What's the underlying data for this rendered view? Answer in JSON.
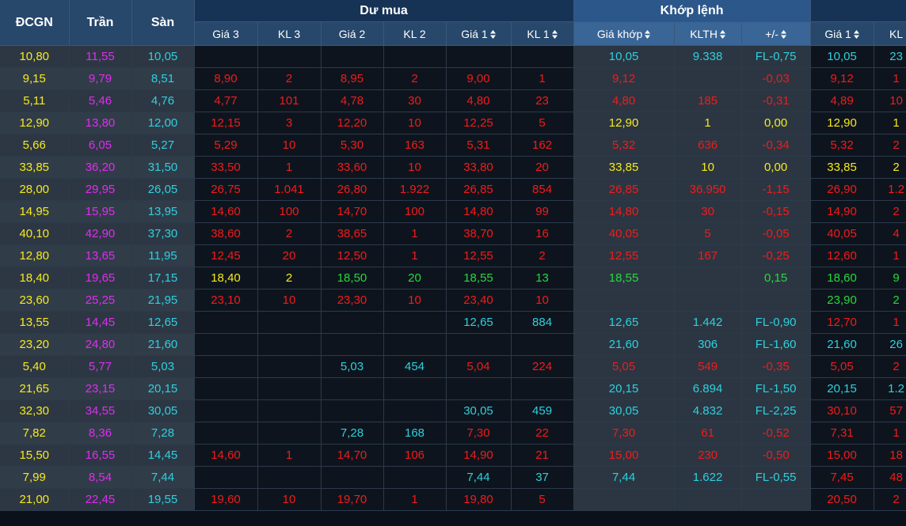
{
  "colors": {
    "ref": "#f5ea1d",
    "ceiling": "#e02cf0",
    "floor": "#2ed0de",
    "up": "#27d83d",
    "down": "#f21b1b",
    "header_bg": "#27476b",
    "match_header_bg": "#2b578a"
  },
  "header": {
    "ref": "ĐCGN",
    "ceiling": "Trần",
    "floor": "Sàn",
    "groups": {
      "bid": "Dư mua",
      "match": "Khớp lệnh",
      "ask": ""
    },
    "columns": {
      "bid_p3": "Giá 3",
      "bid_v3": "KL 3",
      "bid_p2": "Giá 2",
      "bid_v2": "KL 2",
      "bid_p1": "Giá 1",
      "bid_v1": "KL 1",
      "match_price": "Giá khớp",
      "match_vol": "KLTH",
      "match_change": "+/-",
      "ask_p1": "Giá 1",
      "ask_v1": "KL"
    },
    "sort_icon": "sort-up-down-icon"
  },
  "rows": [
    {
      "ref": "10,80",
      "ceil": "11,55",
      "floor": "10,05",
      "b3p": "",
      "b3v": "",
      "b2p": "",
      "b2v": "",
      "b1p": "",
      "b1v": "",
      "mp": "10,05",
      "mv": "9.338",
      "mc": "FL-0,75",
      "a1p": "10,05",
      "a1v": "23",
      "c": {
        "b3": "",
        "b2": "",
        "b1": "",
        "m": "floor",
        "a1": "floor"
      }
    },
    {
      "ref": "9,15",
      "ceil": "9,79",
      "floor": "8,51",
      "b3p": "8,90",
      "b3v": "2",
      "b2p": "8,95",
      "b2v": "2",
      "b1p": "9,00",
      "b1v": "1",
      "mp": "9,12",
      "mv": "",
      "mc": "-0,03",
      "a1p": "9,12",
      "a1v": "1",
      "c": {
        "b3": "down",
        "b2": "down",
        "b1": "down",
        "m": "down",
        "a1": "down"
      }
    },
    {
      "ref": "5,11",
      "ceil": "5,46",
      "floor": "4,76",
      "b3p": "4,77",
      "b3v": "101",
      "b2p": "4,78",
      "b2v": "30",
      "b1p": "4,80",
      "b1v": "23",
      "mp": "4,80",
      "mv": "185",
      "mc": "-0,31",
      "a1p": "4,89",
      "a1v": "10",
      "c": {
        "b3": "down",
        "b2": "down",
        "b1": "down",
        "m": "down",
        "a1": "down"
      }
    },
    {
      "ref": "12,90",
      "ceil": "13,80",
      "floor": "12,00",
      "b3p": "12,15",
      "b3v": "3",
      "b2p": "12,20",
      "b2v": "10",
      "b1p": "12,25",
      "b1v": "5",
      "mp": "12,90",
      "mv": "1",
      "mc": "0,00",
      "a1p": "12,90",
      "a1v": "1",
      "c": {
        "b3": "down",
        "b2": "down",
        "b1": "down",
        "m": "ref",
        "a1": "ref"
      }
    },
    {
      "ref": "5,66",
      "ceil": "6,05",
      "floor": "5,27",
      "b3p": "5,29",
      "b3v": "10",
      "b2p": "5,30",
      "b2v": "163",
      "b1p": "5,31",
      "b1v": "162",
      "mp": "5,32",
      "mv": "636",
      "mc": "-0,34",
      "a1p": "5,32",
      "a1v": "2",
      "c": {
        "b3": "down",
        "b2": "down",
        "b1": "down",
        "m": "down",
        "a1": "down"
      }
    },
    {
      "ref": "33,85",
      "ceil": "36,20",
      "floor": "31,50",
      "b3p": "33,50",
      "b3v": "1",
      "b2p": "33,60",
      "b2v": "10",
      "b1p": "33,80",
      "b1v": "20",
      "mp": "33,85",
      "mv": "10",
      "mc": "0,00",
      "a1p": "33,85",
      "a1v": "2",
      "c": {
        "b3": "down",
        "b2": "down",
        "b1": "down",
        "m": "ref",
        "a1": "ref"
      }
    },
    {
      "ref": "28,00",
      "ceil": "29,95",
      "floor": "26,05",
      "b3p": "26,75",
      "b3v": "1.041",
      "b2p": "26,80",
      "b2v": "1.922",
      "b1p": "26,85",
      "b1v": "854",
      "mp": "26,85",
      "mv": "36.950",
      "mc": "-1,15",
      "a1p": "26,90",
      "a1v": "1.2",
      "c": {
        "b3": "down",
        "b2": "down",
        "b1": "down",
        "m": "down",
        "a1": "down"
      }
    },
    {
      "ref": "14,95",
      "ceil": "15,95",
      "floor": "13,95",
      "b3p": "14,60",
      "b3v": "100",
      "b2p": "14,70",
      "b2v": "100",
      "b1p": "14,80",
      "b1v": "99",
      "mp": "14,80",
      "mv": "30",
      "mc": "-0,15",
      "a1p": "14,90",
      "a1v": "2",
      "c": {
        "b3": "down",
        "b2": "down",
        "b1": "down",
        "m": "down",
        "a1": "down"
      }
    },
    {
      "ref": "40,10",
      "ceil": "42,90",
      "floor": "37,30",
      "b3p": "38,60",
      "b3v": "2",
      "b2p": "38,65",
      "b2v": "1",
      "b1p": "38,70",
      "b1v": "16",
      "mp": "40,05",
      "mv": "5",
      "mc": "-0,05",
      "a1p": "40,05",
      "a1v": "4",
      "c": {
        "b3": "down",
        "b2": "down",
        "b1": "down",
        "m": "down",
        "a1": "down"
      }
    },
    {
      "ref": "12,80",
      "ceil": "13,65",
      "floor": "11,95",
      "b3p": "12,45",
      "b3v": "20",
      "b2p": "12,50",
      "b2v": "1",
      "b1p": "12,55",
      "b1v": "2",
      "mp": "12,55",
      "mv": "167",
      "mc": "-0,25",
      "a1p": "12,60",
      "a1v": "1",
      "c": {
        "b3": "down",
        "b2": "down",
        "b1": "down",
        "m": "down",
        "a1": "down"
      }
    },
    {
      "ref": "18,40",
      "ceil": "19,65",
      "floor": "17,15",
      "b3p": "18,40",
      "b3v": "2",
      "b2p": "18,50",
      "b2v": "20",
      "b1p": "18,55",
      "b1v": "13",
      "mp": "18,55",
      "mv": "",
      "mc": "0,15",
      "a1p": "18,60",
      "a1v": "9",
      "c": {
        "b3": "ref",
        "b2": "up",
        "b1": "up",
        "m": "up",
        "a1": "up"
      }
    },
    {
      "ref": "23,60",
      "ceil": "25,25",
      "floor": "21,95",
      "b3p": "23,10",
      "b3v": "10",
      "b2p": "23,30",
      "b2v": "10",
      "b1p": "23,40",
      "b1v": "10",
      "mp": "",
      "mv": "",
      "mc": "",
      "a1p": "23,90",
      "a1v": "2",
      "c": {
        "b3": "down",
        "b2": "down",
        "b1": "down",
        "m": "",
        "a1": "up"
      }
    },
    {
      "ref": "13,55",
      "ceil": "14,45",
      "floor": "12,65",
      "b3p": "",
      "b3v": "",
      "b2p": "",
      "b2v": "",
      "b1p": "12,65",
      "b1v": "884",
      "mp": "12,65",
      "mv": "1.442",
      "mc": "FL-0,90",
      "a1p": "12,70",
      "a1v": "1",
      "c": {
        "b3": "",
        "b2": "",
        "b1": "floor",
        "m": "floor",
        "a1": "down"
      }
    },
    {
      "ref": "23,20",
      "ceil": "24,80",
      "floor": "21,60",
      "b3p": "",
      "b3v": "",
      "b2p": "",
      "b2v": "",
      "b1p": "",
      "b1v": "",
      "mp": "21,60",
      "mv": "306",
      "mc": "FL-1,60",
      "a1p": "21,60",
      "a1v": "26",
      "c": {
        "b3": "",
        "b2": "",
        "b1": "",
        "m": "floor",
        "a1": "floor"
      }
    },
    {
      "ref": "5,40",
      "ceil": "5,77",
      "floor": "5,03",
      "b3p": "",
      "b3v": "",
      "b2p": "5,03",
      "b2v": "454",
      "b1p": "5,04",
      "b1v": "224",
      "mp": "5,05",
      "mv": "549",
      "mc": "-0,35",
      "a1p": "5,05",
      "a1v": "2",
      "c": {
        "b3": "",
        "b2": "floor",
        "b1": "down",
        "m": "down",
        "a1": "down"
      }
    },
    {
      "ref": "21,65",
      "ceil": "23,15",
      "floor": "20,15",
      "b3p": "",
      "b3v": "",
      "b2p": "",
      "b2v": "",
      "b1p": "",
      "b1v": "",
      "mp": "20,15",
      "mv": "6.894",
      "mc": "FL-1,50",
      "a1p": "20,15",
      "a1v": "1.2",
      "c": {
        "b3": "",
        "b2": "",
        "b1": "",
        "m": "floor",
        "a1": "floor"
      }
    },
    {
      "ref": "32,30",
      "ceil": "34,55",
      "floor": "30,05",
      "b3p": "",
      "b3v": "",
      "b2p": "",
      "b2v": "",
      "b1p": "30,05",
      "b1v": "459",
      "mp": "30,05",
      "mv": "4.832",
      "mc": "FL-2,25",
      "a1p": "30,10",
      "a1v": "57",
      "c": {
        "b3": "",
        "b2": "",
        "b1": "floor",
        "m": "floor",
        "a1": "down"
      }
    },
    {
      "ref": "7,82",
      "ceil": "8,36",
      "floor": "7,28",
      "b3p": "",
      "b3v": "",
      "b2p": "7,28",
      "b2v": "168",
      "b1p": "7,30",
      "b1v": "22",
      "mp": "7,30",
      "mv": "61",
      "mc": "-0,52",
      "a1p": "7,31",
      "a1v": "1",
      "c": {
        "b3": "",
        "b2": "floor",
        "b1": "down",
        "m": "down",
        "a1": "down"
      }
    },
    {
      "ref": "15,50",
      "ceil": "16,55",
      "floor": "14,45",
      "b3p": "14,60",
      "b3v": "1",
      "b2p": "14,70",
      "b2v": "106",
      "b1p": "14,90",
      "b1v": "21",
      "mp": "15,00",
      "mv": "230",
      "mc": "-0,50",
      "a1p": "15,00",
      "a1v": "18",
      "c": {
        "b3": "down",
        "b2": "down",
        "b1": "down",
        "m": "down",
        "a1": "down"
      }
    },
    {
      "ref": "7,99",
      "ceil": "8,54",
      "floor": "7,44",
      "b3p": "",
      "b3v": "",
      "b2p": "",
      "b2v": "",
      "b1p": "7,44",
      "b1v": "37",
      "mp": "7,44",
      "mv": "1.622",
      "mc": "FL-0,55",
      "a1p": "7,45",
      "a1v": "48",
      "c": {
        "b3": "",
        "b2": "",
        "b1": "floor",
        "m": "floor",
        "a1": "down"
      }
    },
    {
      "ref": "21,00",
      "ceil": "22,45",
      "floor": "19,55",
      "b3p": "19,60",
      "b3v": "10",
      "b2p": "19,70",
      "b2v": "1",
      "b1p": "19,80",
      "b1v": "5",
      "mp": "",
      "mv": "",
      "mc": "",
      "a1p": "20,50",
      "a1v": "2",
      "c": {
        "b3": "down",
        "b2": "down",
        "b1": "down",
        "m": "",
        "a1": "down"
      }
    }
  ]
}
